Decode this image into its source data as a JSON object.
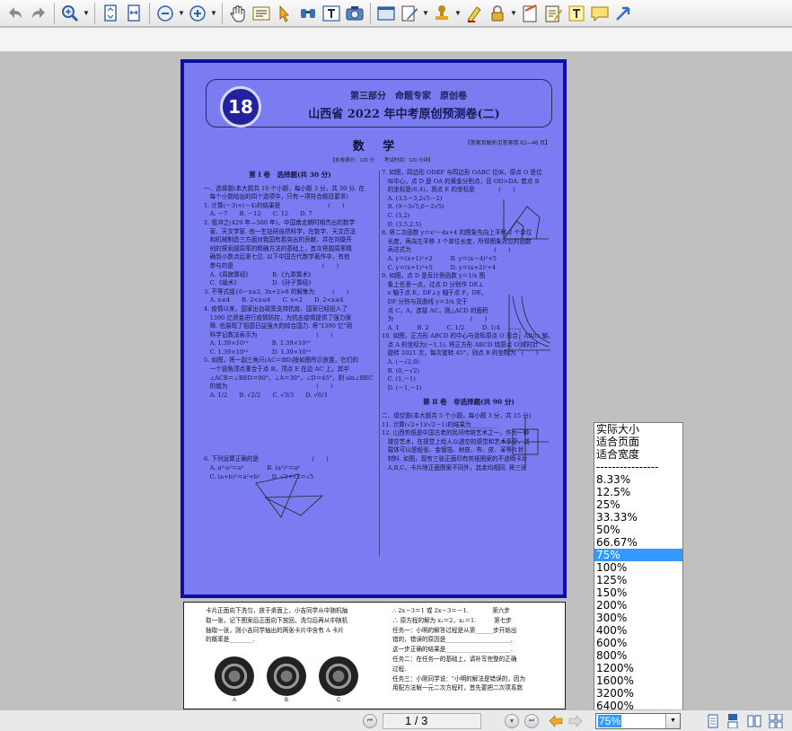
{
  "toolbar": {
    "buttons": [
      "undo-icon",
      "redo-icon",
      "zoom-in-tool-icon",
      "fit-page-icon",
      "fit-width-icon",
      "zoom-out-icon",
      "zoom-plus-icon",
      "hand-tool-icon",
      "text-select-icon",
      "arrow-select-icon",
      "find-icon",
      "typewriter-icon",
      "snapshot-icon",
      "form-icon",
      "sign-pen-icon",
      "stamp-icon",
      "highlight-icon",
      "lock-icon",
      "note-icon",
      "edit-note-icon",
      "text-box-icon",
      "comment-icon",
      "arrow-tool-icon"
    ]
  },
  "page1": {
    "badge": "18",
    "banner_part": "第三部分　命题专家　原创卷",
    "banner_title": "山西省 2022 年中考原创预测卷(二)",
    "subject": "数 学",
    "answer_ref": "【答案及解析见答案卷 K2—46 页】",
    "score_line": "【本卷满分：120 分　　考试时间：120 分钟】",
    "left_col": {
      "section_title": "第 Ⅰ 卷　选择题(共 30 分)",
      "lines": [
        "一、选择题(本大题共 10 个小题，每小题 3 分，共 30 分. 在",
        "　每个小题给出的四个选项中，只有一项符合题目要求)",
        "1. 计算(－3)×(－4)的结果是　　　　　　　　(　　)",
        "　A. －7　　B. －12　　C. 12　　D. 7",
        "2. 祖冲之(429 年—500 年)，中国南北朝时期杰出的数学",
        "　家、天文学家. 他一生钻研自然科学，在数学、天文历法",
        "　和机械制造三方面对我国有着突出的贡献，并在刘徽开",
        "　创的探索圆周率的精确方法的基础上，首次将圆周率精",
        "　确到小数点后第七位. 以下中国古代数学著作中，有他",
        "　参与的是　　　　　　　　　　　　　　　(　　)",
        "　A.《周髀算经》　　　　B.《九章算术》",
        "　C.《缀术》　　　　　　D.《孙子算经》",
        "3. 不等式组{6－x≥2, 3x+2>8 的解集为　　　(　　)",
        "　A. x≤4　　B. 2<x≤4　　C. x<2　　D. 2<x≤4",
        "4. 疫情以来，国家出台政策支持抗疫，国家已经投入了",
        "　1390 亿资金进行疫情防控，为抗击疫情提供了强力保",
        "　障. 也展现了祖国日益强大的综合国力. 将\"1390 亿\"用",
        "　科学记数法表示为　　　　　　　　　　(　　)",
        "　A. 1.39×10¹¹　　　　B. 1.39×10¹⁰",
        "　C. 1.39×10¹²　　　　D. 1.39×10¹³",
        "5. 如图，将一副三角尺(AC＝BD)按如图所示放置，它们的",
        "　一个锐角顶点重合于点 B，顶点 E 在边 AC 上，其中",
        "　∠ACB＝∠BED＝90°，∠A＝30°，∠D＝45°，则 sin∠BEC",
        "　的值为　　　　　　　　　　　　　　　(　　)",
        "　A. 1/2　　B. √2/2　　C. √3/3　　D. √6/3"
      ],
      "q6_lines": [
        "6. 下列运算正确的是　　　　　　　　　(　　)",
        "　A. a³·a³＝a⁹　　　　B. (a²)³＝a⁶",
        "　C. (a+b)²＝a²+b²　　D. √3+√2＝√5"
      ]
    },
    "right_col": {
      "lines": [
        "7. 如图，四边形 ODEF 与四边形 OABC 位似，原点 O 是位",
        "　似中心，点 D 是 OA 的黄金分割点，且 OD>DA. 若点 B",
        "　的坐标是(6,4)，则点 E 的坐标是　　　　(　　)",
        "　A. (3.5－3,2√5－2)",
        "　B. (9－3√5,6－2√5)",
        "　C. (3,2)",
        "　D. (3.5,2.5)",
        "8. 将二次函数 y＝x²－4x+4 的图象先向上平移 2 个单位",
        "　长度，再向左平移 3 个单位长度，所得图象对应的函数",
        "　表达式为　　　　　　　　　　　　　　(　　)",
        "　A. y＝(x+1)²+2　　　B. y＝(x－4)²+5",
        "　C. y＝(x+1)²+5　　　D. y＝(x+2)²+4",
        "9. 如图，点 D 是反比例函数 y＝1/x 图",
        "　象上任意一点，过点 D 分别作 DE⊥",
        "　x 轴于点 E，DF⊥y 轴于点 F，DE，",
        "　DF 分别与双曲线 y＝3/x 交于",
        "　点 C，A，连接 AC，则△ACD 的面积",
        "　为　　　　　　　　　　　　　(　　)",
        "　A. 1　　　B. 2　　　C. 1/2　　　D. 1/4",
        "10. 如图，正方形 ABCD 的中心与坐标原点 O 重合，AB//x 轴，",
        "　点 A 的坐标为(－1,1). 将正方形 ABCD 绕原点 O 顺时针",
        "　旋转 2021 次，每次旋转 45°，则点 B 的坐标为　(　　)",
        "　A. (－√2,0)",
        "　B. (0,－√2)",
        "　C. (1,－1)",
        "　D. (－1,－1)"
      ],
      "section2_title": "第 Ⅱ 卷　非选择题(共 90 分)",
      "section2_lines": [
        "二、填空题(本大题共 5 个小题，每小题 3 分，共 15 分)",
        "11. 计算(√2+1)(√2－1)的结果为________.",
        "12. 山西剪纸是中国古老的民间传统艺术之一，作为一种",
        "　镂空艺术，在视觉上给人以透空的感觉和艺术享受，其",
        "　载体可以是纸张、金银箔、树皮、布、皮、革等片状",
        "　材料. 如图，现有三张正面印有剪纸图案的不透明卡片",
        "　A,B,C，卡片除正面图案不同外，其余均相同. 将三张"
      ]
    }
  },
  "page2": {
    "left_lines": [
      "卡片正面向下洗匀，放于桌面上，小吉同学从中随机抽",
      "取一张，记下图案后正面向下放回，洗匀后再从中随机",
      "抽取一张，则小吉同学抽出的两张卡片中含有 A 卡片",
      "的概率是________."
    ],
    "coin_labels": [
      "A",
      "B",
      "C"
    ],
    "right_lines": [
      "∴ 2x－3＝1 或 2x－3＝－1.　　　　第六步",
      "∴ 原方程的解为 x₁＝2，x₂＝1.　　　第七步",
      "任务一：小明的解答过程是从第______步开始出",
      "错的，错误的原因是______________________,",
      "这一步正确的结果是______________________.",
      "任务二：在任务一的基础上，请补写完整的正确",
      "过程.",
      "任务三：小刚同学说：\"小明的解法是错误的，因为",
      "用配方法解一元二次方程时，首先要把二次项系数"
    ]
  },
  "zoom_menu": {
    "items": [
      "实际大小",
      "适合页面",
      "适合宽度",
      "----------------",
      "8.33%",
      "12.5%",
      "25%",
      "33.33%",
      "50%",
      "66.67%",
      "75%",
      "100%",
      "125%",
      "150%",
      "200%",
      "300%",
      "400%",
      "600%",
      "800%",
      "1200%",
      "1600%",
      "3200%",
      "6400%"
    ],
    "selected": "75%"
  },
  "statusbar": {
    "page_indicator": "1 / 3",
    "zoom_value": "75%"
  }
}
